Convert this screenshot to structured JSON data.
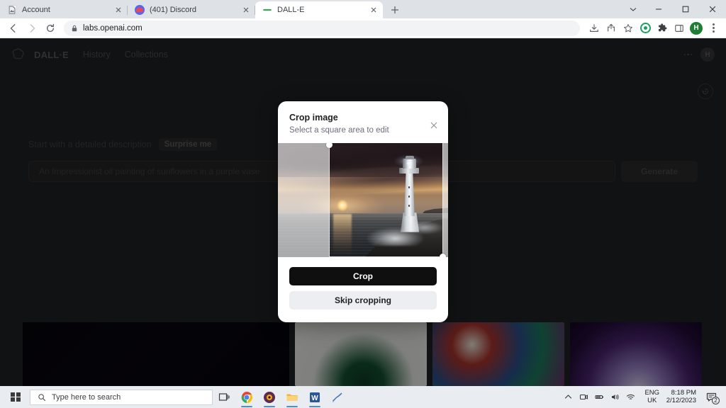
{
  "browser": {
    "tabs": [
      {
        "title": "Account",
        "favicon": "document-icon",
        "active": false
      },
      {
        "title": "(401) Discord",
        "favicon": "discord-icon",
        "active": false
      },
      {
        "title": "DALL-E",
        "favicon": "dalle-icon",
        "active": true
      }
    ],
    "new_tab_label": "+",
    "address": "labs.openai.com",
    "window_controls": {
      "minimize": "–",
      "maximize": "□",
      "close": "✕"
    },
    "toolbar_icons": [
      "install-icon",
      "share-icon",
      "bookmark-star-icon",
      "grammarly-icon",
      "extensions-puzzle-icon",
      "sidepanel-icon",
      "profile-avatar",
      "chrome-menu-kebab"
    ],
    "profile_initial": "H"
  },
  "dalle": {
    "brand": "DALL·E",
    "nav": [
      {
        "label": "History"
      },
      {
        "label": "Collections"
      }
    ],
    "account_initial": "H",
    "prompt_hint": "Start with a detailed description",
    "surprise_label": "Surprise me",
    "prompt_value": "An Impressionist oil painting of sunflowers in a purple vase",
    "generate_label": "Generate",
    "history_icon": "history-clock-icon",
    "gallery_count": 4
  },
  "modal": {
    "title": "Crop image",
    "subtitle": "Select a square area to edit",
    "close_icon": "close-icon",
    "crop_button": "Crop",
    "skip_button": "Skip cropping",
    "image_description": "Lighthouse on rocky shore at sunset over the sea",
    "accent_dark": "#0f0f10",
    "accent_light": "#eceef1"
  },
  "taskbar": {
    "start_icon": "windows-start-icon",
    "search_placeholder": "Type here to search",
    "search_icon": "search-icon",
    "taskview_icon": "task-view-icon",
    "apps": [
      "chrome-icon",
      "media-player-icon",
      "file-explorer-icon",
      "word-icon",
      "paint-icon"
    ],
    "tray": {
      "overflow_icon": "chevron-up-icon",
      "icons": [
        "meet-now-icon",
        "battery-icon",
        "volume-icon",
        "wifi-icon"
      ],
      "language_line1": "ENG",
      "language_line2": "UK",
      "time": "8:18 PM",
      "date": "2/12/2023",
      "notification_count": "2"
    }
  }
}
